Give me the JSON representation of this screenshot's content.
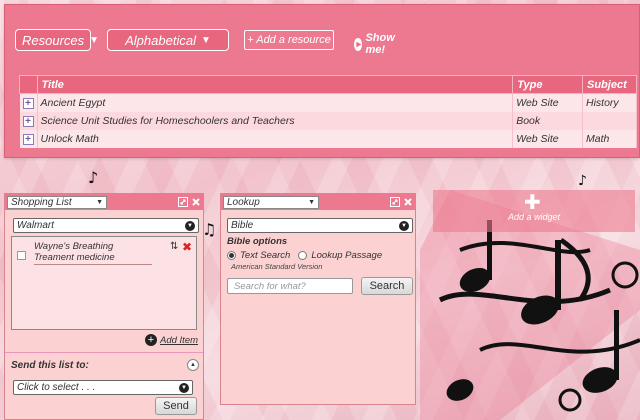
{
  "toolbar": {
    "resources_label": "Resources",
    "sort_label": "Alphabetical",
    "add_resource_label": "+ Add a resource",
    "show_me_label": "Show me!"
  },
  "table": {
    "headers": [
      "Title",
      "Type",
      "Subject"
    ],
    "rows": [
      {
        "title": "Ancient Egypt",
        "type": "Web Site",
        "subject": "History"
      },
      {
        "title": "Science Unit Studies for Homeschoolers and Teachers",
        "type": "Book",
        "subject": ""
      },
      {
        "title": "Unlock Math",
        "type": "Web Site",
        "subject": "Math"
      }
    ]
  },
  "shopping": {
    "widget_select": "Shopping List",
    "store": "Walmart",
    "items": [
      "Wayne's Breathing Treament medicine"
    ],
    "add_item_label": "Add Item",
    "send_label": "Send this list to:",
    "select_placeholder": "Click to select . . .",
    "send_button": "Send"
  },
  "lookup": {
    "widget_select": "Lookup",
    "source": "Bible",
    "options_label": "Bible options",
    "radio_text": "Text Search",
    "radio_passage": "Lookup Passage",
    "version": "American Standard Version",
    "search_placeholder": "Search for what?",
    "search_button": "Search"
  },
  "add_widget": {
    "label": "Add a widget"
  },
  "colors": {
    "accent": "#ec7990",
    "panel": "#fcd1d1",
    "delete": "#dd2222"
  }
}
